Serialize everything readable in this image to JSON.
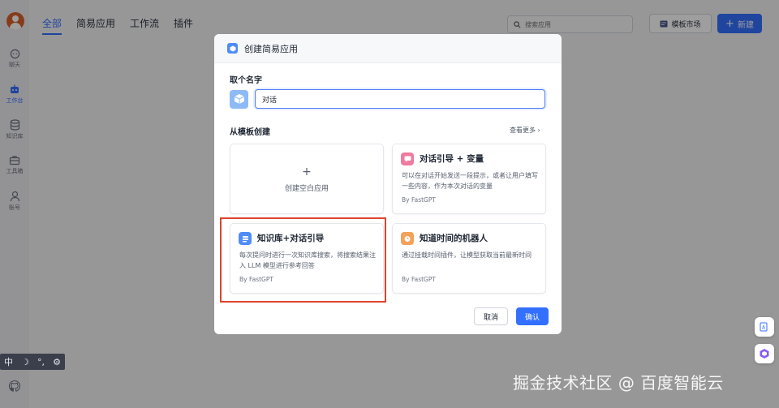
{
  "sidebar": {
    "items": [
      {
        "label": "聊天",
        "icon": "chat-icon"
      },
      {
        "label": "工作台",
        "icon": "robot-icon",
        "active": true
      },
      {
        "label": "知识库",
        "icon": "database-icon"
      },
      {
        "label": "工具箱",
        "icon": "toolbox-icon"
      },
      {
        "label": "账号",
        "icon": "user-icon"
      }
    ]
  },
  "toolbar_mini": {
    "lang": "中",
    "moon": "☽",
    "dots": "°,",
    "gear": "⚙"
  },
  "topnav": {
    "tabs": [
      "全部",
      "简易应用",
      "工作流",
      "插件"
    ]
  },
  "search": {
    "placeholder": "搜索应用"
  },
  "header_buttons": {
    "market": "模板市场",
    "new": "新建"
  },
  "modal": {
    "title": "创建简易应用",
    "name_label": "取个名字",
    "name_value": "对话",
    "template_label": "从模板创建",
    "more_link": "查看更多 ›",
    "blank_card": {
      "plus": "+",
      "label": "创建空白应用"
    },
    "cards": [
      {
        "title": "对话引导 + 变量",
        "desc": "可以在对话开始发送一段提示，或者让用户填写一些内容，作为本次对话的变量",
        "author": "By FastGPT",
        "icon_color": "#f07aa0"
      },
      {
        "title": "知识库+对话引导",
        "desc": "每次提问时进行一次知识库搜索，将搜索结果注入 LLM 模型进行参考回答",
        "author": "By FastGPT",
        "icon_color": "#4e8cf7"
      },
      {
        "title": "知道时间的机器人",
        "desc": "通过挂载时间插件，让模型获取当前最新时间",
        "author": "By FastGPT",
        "icon_color": "#f4a259"
      }
    ],
    "cancel": "取消",
    "confirm": "确认"
  },
  "watermark": "掘金技术社区 @ 百度智能云",
  "colors": {
    "accent": "#3370ff",
    "highlight": "#e0442b",
    "avatar": "#d9622d"
  }
}
